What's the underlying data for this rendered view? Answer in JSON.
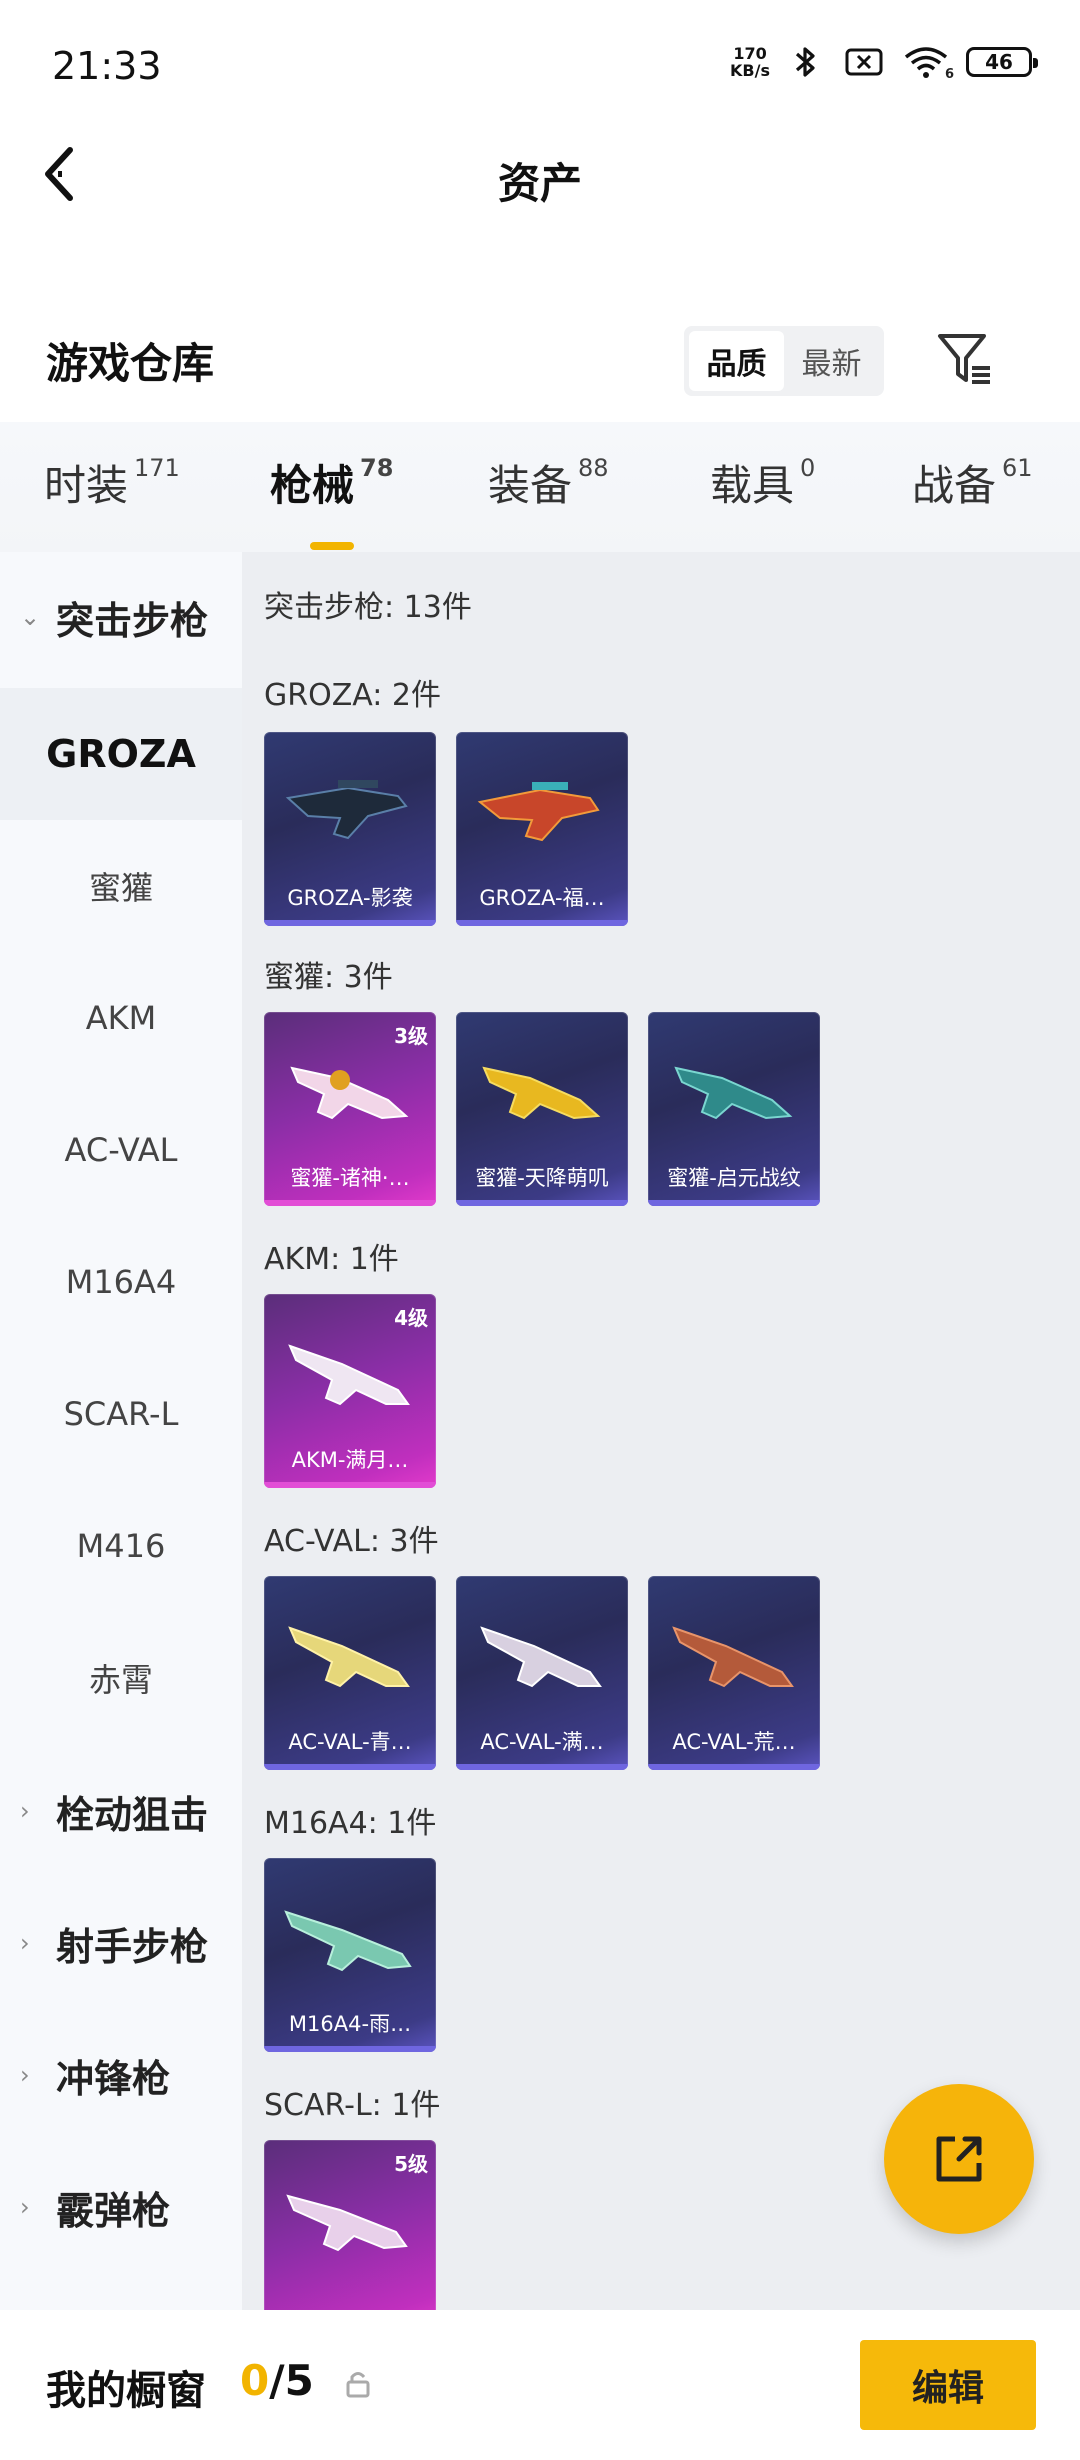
{
  "status_bar": {
    "time": "21:33",
    "net_speed_value": "170",
    "net_speed_unit": "KB/s",
    "wifi_number": "6",
    "battery": "46"
  },
  "header": {
    "title": "资产"
  },
  "warehouse": {
    "title": "游戏仓库",
    "sort_options": [
      "品质",
      "最新"
    ],
    "sort_selected": "品质"
  },
  "tabs": [
    {
      "label": "时装",
      "count": "171"
    },
    {
      "label": "枪械",
      "count": "78",
      "active": true
    },
    {
      "label": "装备",
      "count": "88"
    },
    {
      "label": "载具",
      "count": "0"
    },
    {
      "label": "战备",
      "count": "61"
    }
  ],
  "sidebar": {
    "group_expanded": "突击步枪",
    "items": [
      "GROZA",
      "蜜獾",
      "AKM",
      "AC-VAL",
      "M16A4",
      "SCAR-L",
      "M416",
      "赤霄"
    ],
    "selected": "GROZA",
    "groups_collapsed": [
      "栓动狙击",
      "射手步枪",
      "冲锋枪",
      "霰弹枪"
    ]
  },
  "content": {
    "summary": "突击步枪: 13件",
    "sections": [
      {
        "title": "GROZA: 2件",
        "cards": [
          {
            "name": "GROZA-影袭",
            "rarity": "blue",
            "level": ""
          },
          {
            "name": "GROZA-福…",
            "rarity": "blue",
            "level": ""
          }
        ]
      },
      {
        "title": "蜜獾: 3件",
        "cards": [
          {
            "name": "蜜獾-诸神·…",
            "rarity": "purple",
            "level": "3级"
          },
          {
            "name": "蜜獾-天降萌叽",
            "rarity": "blue",
            "level": ""
          },
          {
            "name": "蜜獾-启元战纹",
            "rarity": "blue",
            "level": ""
          }
        ]
      },
      {
        "title": "AKM: 1件",
        "cards": [
          {
            "name": "AKM-满月…",
            "rarity": "purple",
            "level": "4级"
          }
        ]
      },
      {
        "title": "AC-VAL: 3件",
        "cards": [
          {
            "name": "AC-VAL-青…",
            "rarity": "blue",
            "level": ""
          },
          {
            "name": "AC-VAL-满…",
            "rarity": "blue",
            "level": ""
          },
          {
            "name": "AC-VAL-荒…",
            "rarity": "blue",
            "level": ""
          }
        ]
      },
      {
        "title": "M16A4: 1件",
        "cards": [
          {
            "name": "M16A4-雨…",
            "rarity": "blue",
            "level": ""
          }
        ]
      },
      {
        "title": "SCAR-L: 1件",
        "cards": [
          {
            "name": "",
            "rarity": "purple",
            "level": "5级"
          }
        ]
      }
    ]
  },
  "bottom_bar": {
    "label": "我的橱窗",
    "current": "0",
    "total": "/5",
    "edit_label": "编辑"
  },
  "colors": {
    "accent": "#f2b400",
    "rarity_blue": "#2f3268",
    "rarity_purple": "#a52fb0"
  },
  "icons": [
    "back-arrow-icon",
    "bluetooth-icon",
    "no-sim-icon",
    "wifi-icon",
    "battery-icon",
    "filter-icon",
    "chevron-down-icon",
    "chevron-right-icon",
    "share-icon",
    "lock-icon"
  ]
}
